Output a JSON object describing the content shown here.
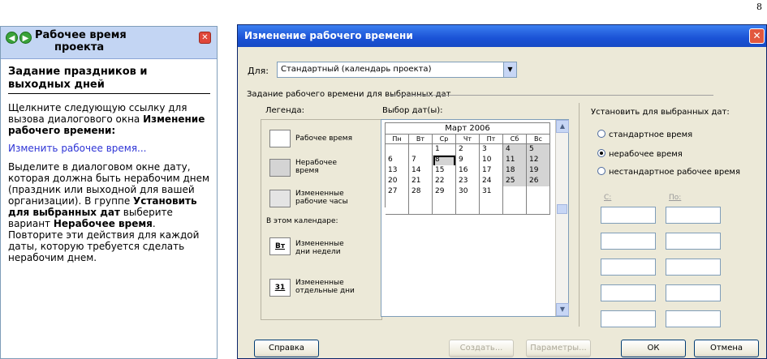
{
  "page_number": "8",
  "task_pane": {
    "title_line1": "Рабочее время",
    "title_line2": "проекта",
    "section_heading": "Задание праздников и выходных дней",
    "para1_text": "Щелкните следующую ссылку для вызова диалогового окна ",
    "para1_bold": "Изменение рабочего времени",
    "para1_end": ":",
    "link": "Изменить рабочее время...",
    "para2_text1": "Выделите в диалоговом окне дату, которая должна быть нерабочим днем (праздник или выходной для вашей организации). В группе ",
    "para2_bold1": "Установить для выбранных дат",
    "para2_text2": " выберите вариант ",
    "para2_bold2": "Нерабочее время",
    "para2_text3": ". Повторите эти действия для каждой даты, которую требуется сделать нерабочим днем."
  },
  "dialog": {
    "title": "Изменение рабочего времени",
    "for_label": "Для:",
    "for_value": "Стандартный (календарь проекта)",
    "group_title": "Задание рабочего времени для выбранных дат",
    "legend": {
      "label": "Легенда:",
      "working": "Рабочее время",
      "nonworking_1": "Нерабочее",
      "nonworking_2": "время",
      "nondefault_1": "Измененные",
      "nondefault_2": "рабочие часы",
      "in_calendar": "В этом календаре:",
      "weekday_sample": "Вт",
      "weekday_1": "Измененные",
      "weekday_2": "дни недели",
      "day_sample": "31",
      "day_1": "Измененные",
      "day_2": "отдельные дни"
    },
    "select_label": "Выбор дат(ы):",
    "calendar": {
      "month": "Март 2006",
      "weekdays": [
        "Пн",
        "Вт",
        "Ср",
        "Чт",
        "Пт",
        "Сб",
        "Вс"
      ],
      "rows": [
        [
          "",
          "",
          "1",
          "2",
          "3",
          "4",
          "5"
        ],
        [
          "6",
          "7",
          "8",
          "9",
          "10",
          "11",
          "12"
        ],
        [
          "13",
          "14",
          "15",
          "16",
          "17",
          "18",
          "19"
        ],
        [
          "20",
          "21",
          "22",
          "23",
          "24",
          "25",
          "26"
        ],
        [
          "27",
          "28",
          "29",
          "30",
          "31",
          "",
          ""
        ],
        [
          "",
          "",
          "",
          "",
          "",
          "",
          ""
        ]
      ],
      "selected": "8"
    },
    "set_for_label": "Установить для выбранных дат:",
    "radio_standard": "стандартное время",
    "radio_nonworking": "нерабочее время",
    "radio_nonstandard": "нестандартное рабочее время",
    "from_label": "С:",
    "to_label": "По:",
    "buttons": {
      "help": "Справка",
      "new": "Создать...",
      "options": "Параметры...",
      "ok": "ОК",
      "cancel": "Отмена"
    }
  }
}
